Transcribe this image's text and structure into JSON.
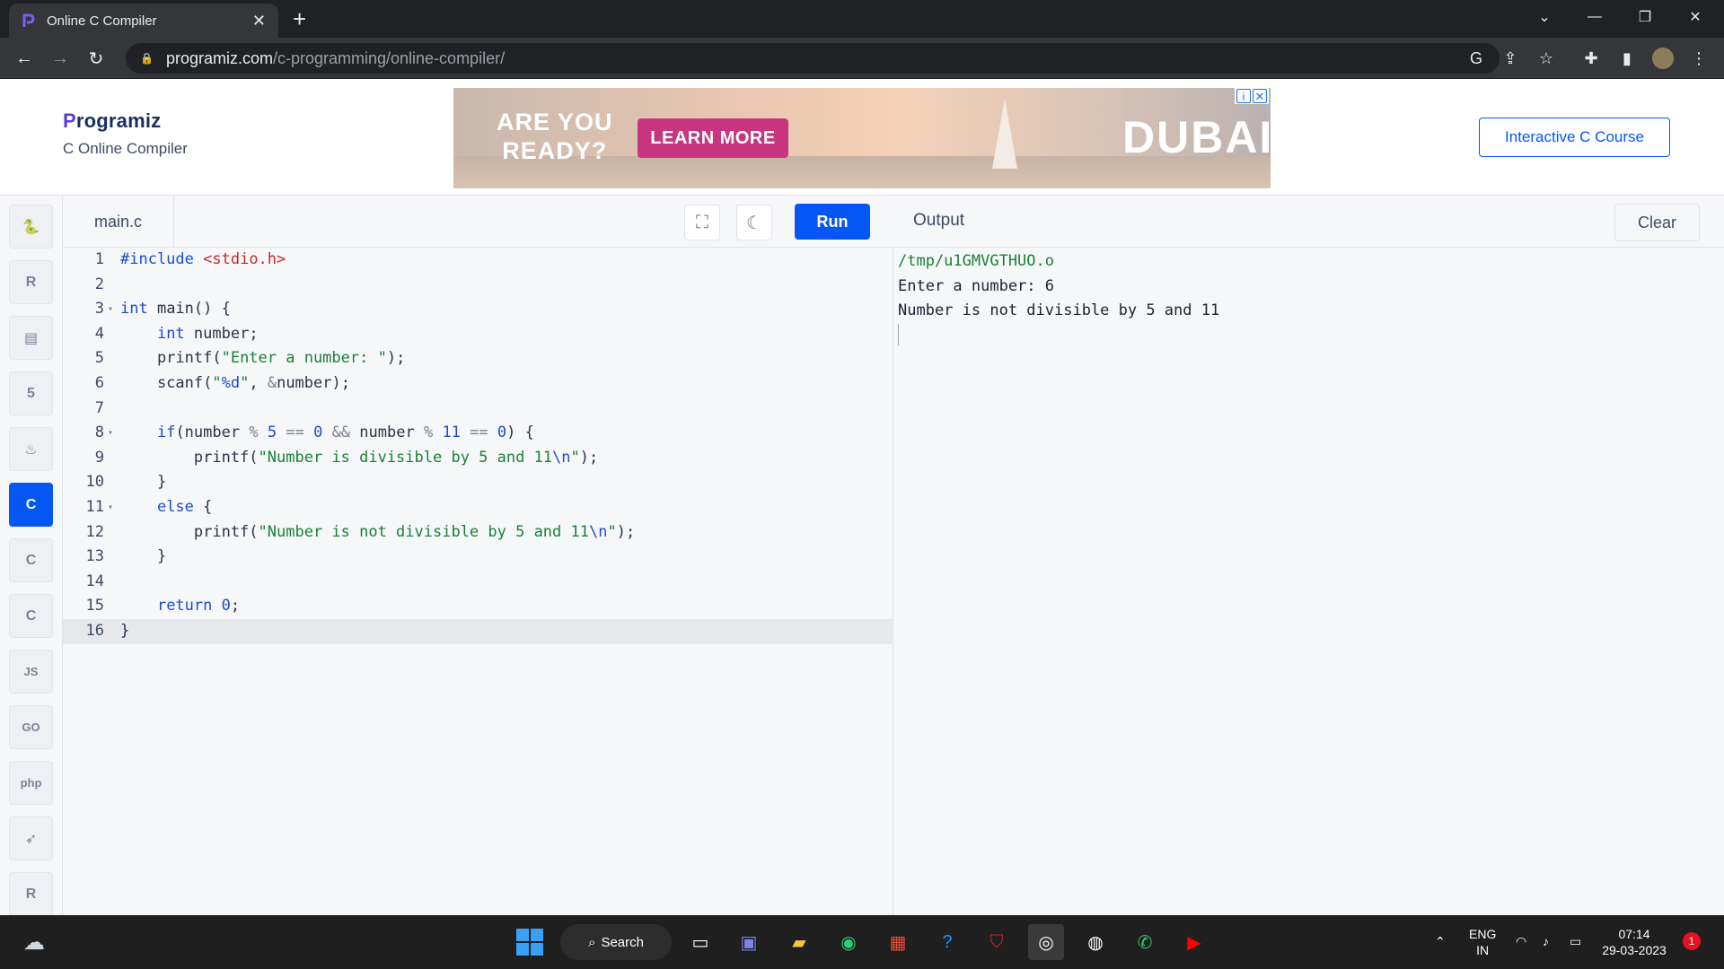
{
  "browser": {
    "tab_title": "Online C Compiler",
    "tab_close": "✕",
    "new_tab": "+",
    "url_host": "programiz.com",
    "url_path": "/c-programming/online-compiler/"
  },
  "header": {
    "brand": "Programiz",
    "subtitle": "C Online Compiler",
    "course_button": "Interactive C Course",
    "ad": {
      "headline_1": "ARE YOU",
      "headline_2": "READY?",
      "cta": "LEARN MORE",
      "brand_mark": "DUBAI"
    }
  },
  "sidebar": {
    "items": [
      {
        "name": "python",
        "glyph": "🐍"
      },
      {
        "name": "r",
        "glyph": "R"
      },
      {
        "name": "sql",
        "glyph": "▤"
      },
      {
        "name": "html",
        "glyph": "5"
      },
      {
        "name": "java",
        "glyph": "♨"
      },
      {
        "name": "c",
        "glyph": "C"
      },
      {
        "name": "cpp",
        "glyph": "C"
      },
      {
        "name": "csharp",
        "glyph": "C"
      },
      {
        "name": "js",
        "glyph": "JS"
      },
      {
        "name": "go",
        "glyph": "GO"
      },
      {
        "name": "php",
        "glyph": "php"
      },
      {
        "name": "swift",
        "glyph": "➶"
      },
      {
        "name": "rust",
        "glyph": "R"
      }
    ]
  },
  "editor": {
    "file_name": "main.c",
    "run_label": "Run",
    "lines": [
      "#include <stdio.h>",
      "",
      "int main() {",
      "    int number;",
      "    printf(\"Enter a number: \");",
      "    scanf(\"%d\", &number);",
      "",
      "    if(number % 5 == 0 && number % 11 == 0) {",
      "        printf(\"Number is divisible by 5 and 11\\n\");",
      "    }",
      "    else {",
      "        printf(\"Number is not divisible by 5 and 11\\n\");",
      "    }",
      "",
      "    return 0;",
      "}"
    ]
  },
  "output": {
    "title": "Output",
    "clear_label": "Clear",
    "lines": [
      "/tmp/u1GMVGTHUO.o",
      "Enter a number: 6",
      "Number is not divisible by 5 and 11"
    ]
  },
  "taskbar": {
    "search_label": "Search",
    "lang_1": "ENG",
    "lang_2": "IN",
    "time": "07:14",
    "date": "29-03-2023",
    "notification_count": "1"
  }
}
